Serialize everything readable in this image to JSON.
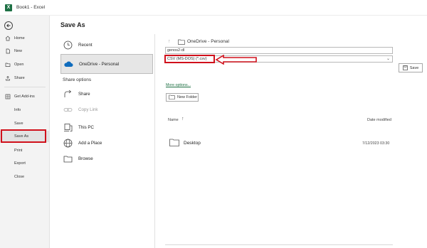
{
  "window": {
    "title": "Book1 - Excel",
    "app_icon_letter": "X"
  },
  "nav": {
    "items": [
      {
        "label": "Home",
        "icon": "home-icon"
      },
      {
        "label": "New",
        "icon": "new-document-icon"
      },
      {
        "label": "Open",
        "icon": "open-folder-icon"
      },
      {
        "label": "Share",
        "icon": "share-icon"
      },
      {
        "label": "Get Add-ins",
        "icon": "store-icon"
      },
      {
        "label": "Info"
      },
      {
        "label": "Save"
      },
      {
        "label": "Save As"
      },
      {
        "label": "Print"
      },
      {
        "label": "Export"
      },
      {
        "label": "Close"
      }
    ],
    "selected": "Save As"
  },
  "page_title": "Save As",
  "locations": {
    "recent": "Recent",
    "onedrive": "OneDrive - Personal",
    "share_options_header": "Share options",
    "share": "Share",
    "copy_link": "Copy Link",
    "this_pc": "This PC",
    "add_place": "Add a Place",
    "browse": "Browse"
  },
  "breadcrumb": {
    "current": "OneDrive - Personal"
  },
  "save_form": {
    "filename": "genos2-dl",
    "filetype": "CSV (MS-DOS) (*.csv)",
    "save_label": "Save",
    "more_options": "More options...",
    "new_folder": "New Folder"
  },
  "file_list": {
    "columns": {
      "name": "Name",
      "date": "Date modified"
    },
    "rows": [
      {
        "name": "Desktop",
        "date": "7/12/2023 03:30",
        "icon": "folder-icon"
      }
    ]
  },
  "colors": {
    "accent_green": "#1d6f42",
    "highlight_red": "#d0101b"
  }
}
